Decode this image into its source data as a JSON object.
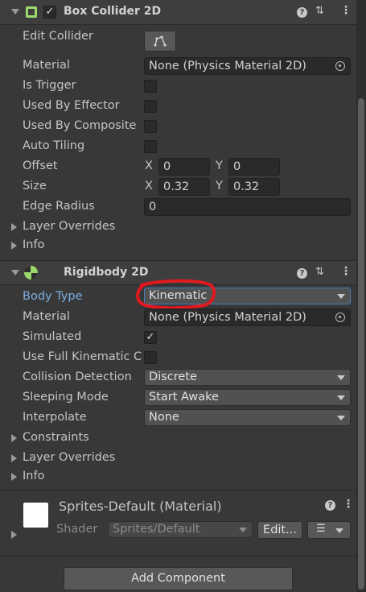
{
  "box_collider": {
    "title": "Box Collider 2D",
    "edit_collider_label": "Edit Collider",
    "material_label": "Material",
    "material_value": "None (Physics Material 2D)",
    "is_trigger_label": "Is Trigger",
    "used_by_effector_label": "Used By Effector",
    "used_by_composite_label": "Used By Composite",
    "auto_tiling_label": "Auto Tiling",
    "offset_label": "Offset",
    "offset_x": "0",
    "offset_y": "0",
    "size_label": "Size",
    "size_x": "0.32",
    "size_y": "0.32",
    "edge_radius_label": "Edge Radius",
    "edge_radius_value": "0",
    "layer_overrides_label": "Layer Overrides",
    "info_label": "Info",
    "axis_x": "X",
    "axis_y": "Y"
  },
  "rigidbody": {
    "title": "Rigidbody 2D",
    "body_type_label": "Body Type",
    "body_type_value": "Kinematic",
    "material_label": "Material",
    "material_value": "None (Physics Material 2D)",
    "simulated_label": "Simulated",
    "use_full_kinematic_label": "Use Full Kinematic C",
    "collision_detection_label": "Collision Detection",
    "collision_detection_value": "Discrete",
    "sleeping_mode_label": "Sleeping Mode",
    "sleeping_mode_value": "Start Awake",
    "interpolate_label": "Interpolate",
    "interpolate_value": "None",
    "constraints_label": "Constraints",
    "layer_overrides_label": "Layer Overrides",
    "info_label": "Info"
  },
  "material_section": {
    "title": "Sprites-Default (Material)",
    "shader_label": "Shader",
    "shader_value": "Sprites/Default",
    "edit_button": "Edit..."
  },
  "add_component_button": "Add Component",
  "colors": {
    "background": "#383838",
    "header": "#3e3e3e",
    "field": "#2a2a2a",
    "label_highlight": "#7baee0",
    "annotation_red": "#e0191f"
  }
}
